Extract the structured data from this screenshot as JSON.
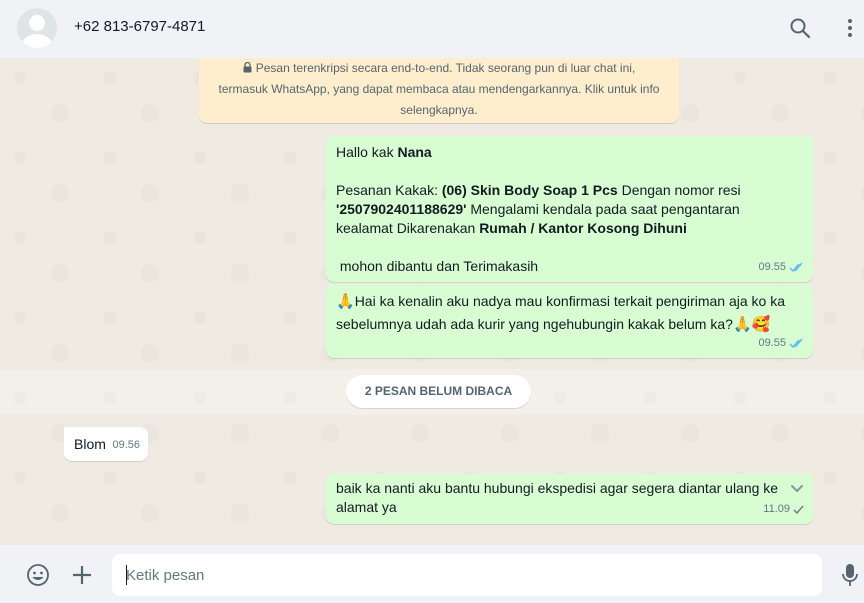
{
  "header": {
    "contact_name": "+62 813-6797-4871",
    "icons": {
      "avatar": "default-avatar",
      "search": "search-icon",
      "menu": "menu-dots-icon"
    }
  },
  "encryption_notice": {
    "line1": "Pesan terenkripsi secara end-to-end. Tidak seorang pun di luar chat ini,",
    "line2": "termasuk WhatsApp, yang dapat membaca atau mendengarkannya. Klik untuk info",
    "line3": "selengkapnya."
  },
  "messages": [
    {
      "direction": "out",
      "greeting": "Hallo kak ",
      "greeting_name": "Nana",
      "p1": "Pesanan Kakak: ",
      "p1_bold": "(06) Skin Body Soap 1 Pcs",
      "p1_rest": " Dengan nomor resi",
      "p2_bold": "'2507902401188629'",
      "p2_rest": " Mengalami kendala pada saat pengantaran",
      "p3": "kealamat Dikarenakan ",
      "p3_bold": "Rumah / Kantor Kosong Dihuni",
      "p4": " mohon dibantu dan Terimakasih",
      "time": "09.55",
      "status": "read"
    },
    {
      "direction": "out",
      "line1": "Hai ka kenalin aku nadya mau konfirmasi terkait pengiriman aja ko ka",
      "line2": "sebelumnya udah ada kurir yang ngehubungin kakak belum ka?",
      "time": "09.55",
      "status": "read"
    },
    {
      "direction": "in",
      "text": "Blom",
      "time": "09.56"
    },
    {
      "direction": "out",
      "line1": "baik ka nanti aku bantu hubungi ekspedisi agar segera diantar ulang ke",
      "line2": "alamat ya",
      "time": "11.09",
      "status": "sent"
    }
  ],
  "unread_divider": "2 PESAN BELUM DIBACA",
  "composer": {
    "placeholder": "Ketik pesan",
    "icons": {
      "emoji": "emoji-icon",
      "attach": "plus-icon",
      "voice": "mic-icon"
    }
  },
  "colors": {
    "outgoing_bubble": "#d9fdd3",
    "incoming_bubble": "#ffffff",
    "read_ticks": "#53bdeb",
    "notice_bg": "#ffeecd",
    "chat_bg": "#efeae2"
  }
}
